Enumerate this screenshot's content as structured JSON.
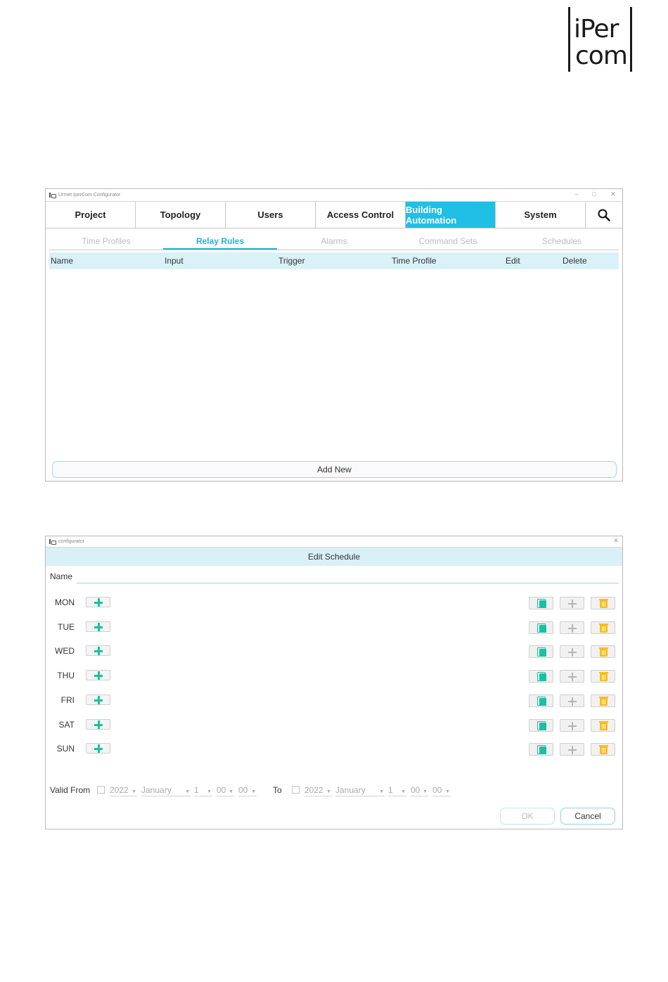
{
  "logo": {
    "line1": "iPer",
    "line2": "com"
  },
  "window1": {
    "title": "Urmet IperCom Configurator",
    "controls": [
      "–",
      "□",
      "✕"
    ],
    "main_tabs": [
      {
        "label": "Project"
      },
      {
        "label": "Topology"
      },
      {
        "label": "Users"
      },
      {
        "label": "Access Control"
      },
      {
        "label": "Building Automation",
        "active": true
      },
      {
        "label": "System"
      }
    ],
    "search_icon": "search-icon",
    "sub_tabs": [
      {
        "label": "Time Profiles"
      },
      {
        "label": "Relay Rules",
        "active": true
      },
      {
        "label": "Alarms"
      },
      {
        "label": "Command Sets"
      },
      {
        "label": "Schedules"
      }
    ],
    "columns": [
      "Name",
      "Input",
      "Trigger",
      "Time Profile",
      "Edit",
      "Delete"
    ],
    "rows": [],
    "add_new_label": "Add New"
  },
  "window2": {
    "title": "configurator",
    "close": "✕",
    "dialog_title": "Edit Schedule",
    "name_label": "Name",
    "name_value": "",
    "days": [
      "MON",
      "TUE",
      "WED",
      "THU",
      "FRI",
      "SAT",
      "SUN"
    ],
    "day_actions": [
      "copy-icon",
      "plus-icon",
      "trash-icon"
    ],
    "valid_from_label": "Valid From",
    "from": {
      "year": "2022",
      "month": "January",
      "day": "1",
      "hour": "00",
      "minute": "00"
    },
    "to_label": "To",
    "to": {
      "year": "2022",
      "month": "January",
      "day": "1",
      "hour": "00",
      "minute": "00"
    },
    "ok_label": "OK",
    "cancel_label": "Cancel"
  },
  "colors": {
    "accent": "#20bfe6",
    "header_bg": "#daf1f8",
    "add_green": "#17c2a2",
    "trash_yellow": "#f3bf1f"
  }
}
